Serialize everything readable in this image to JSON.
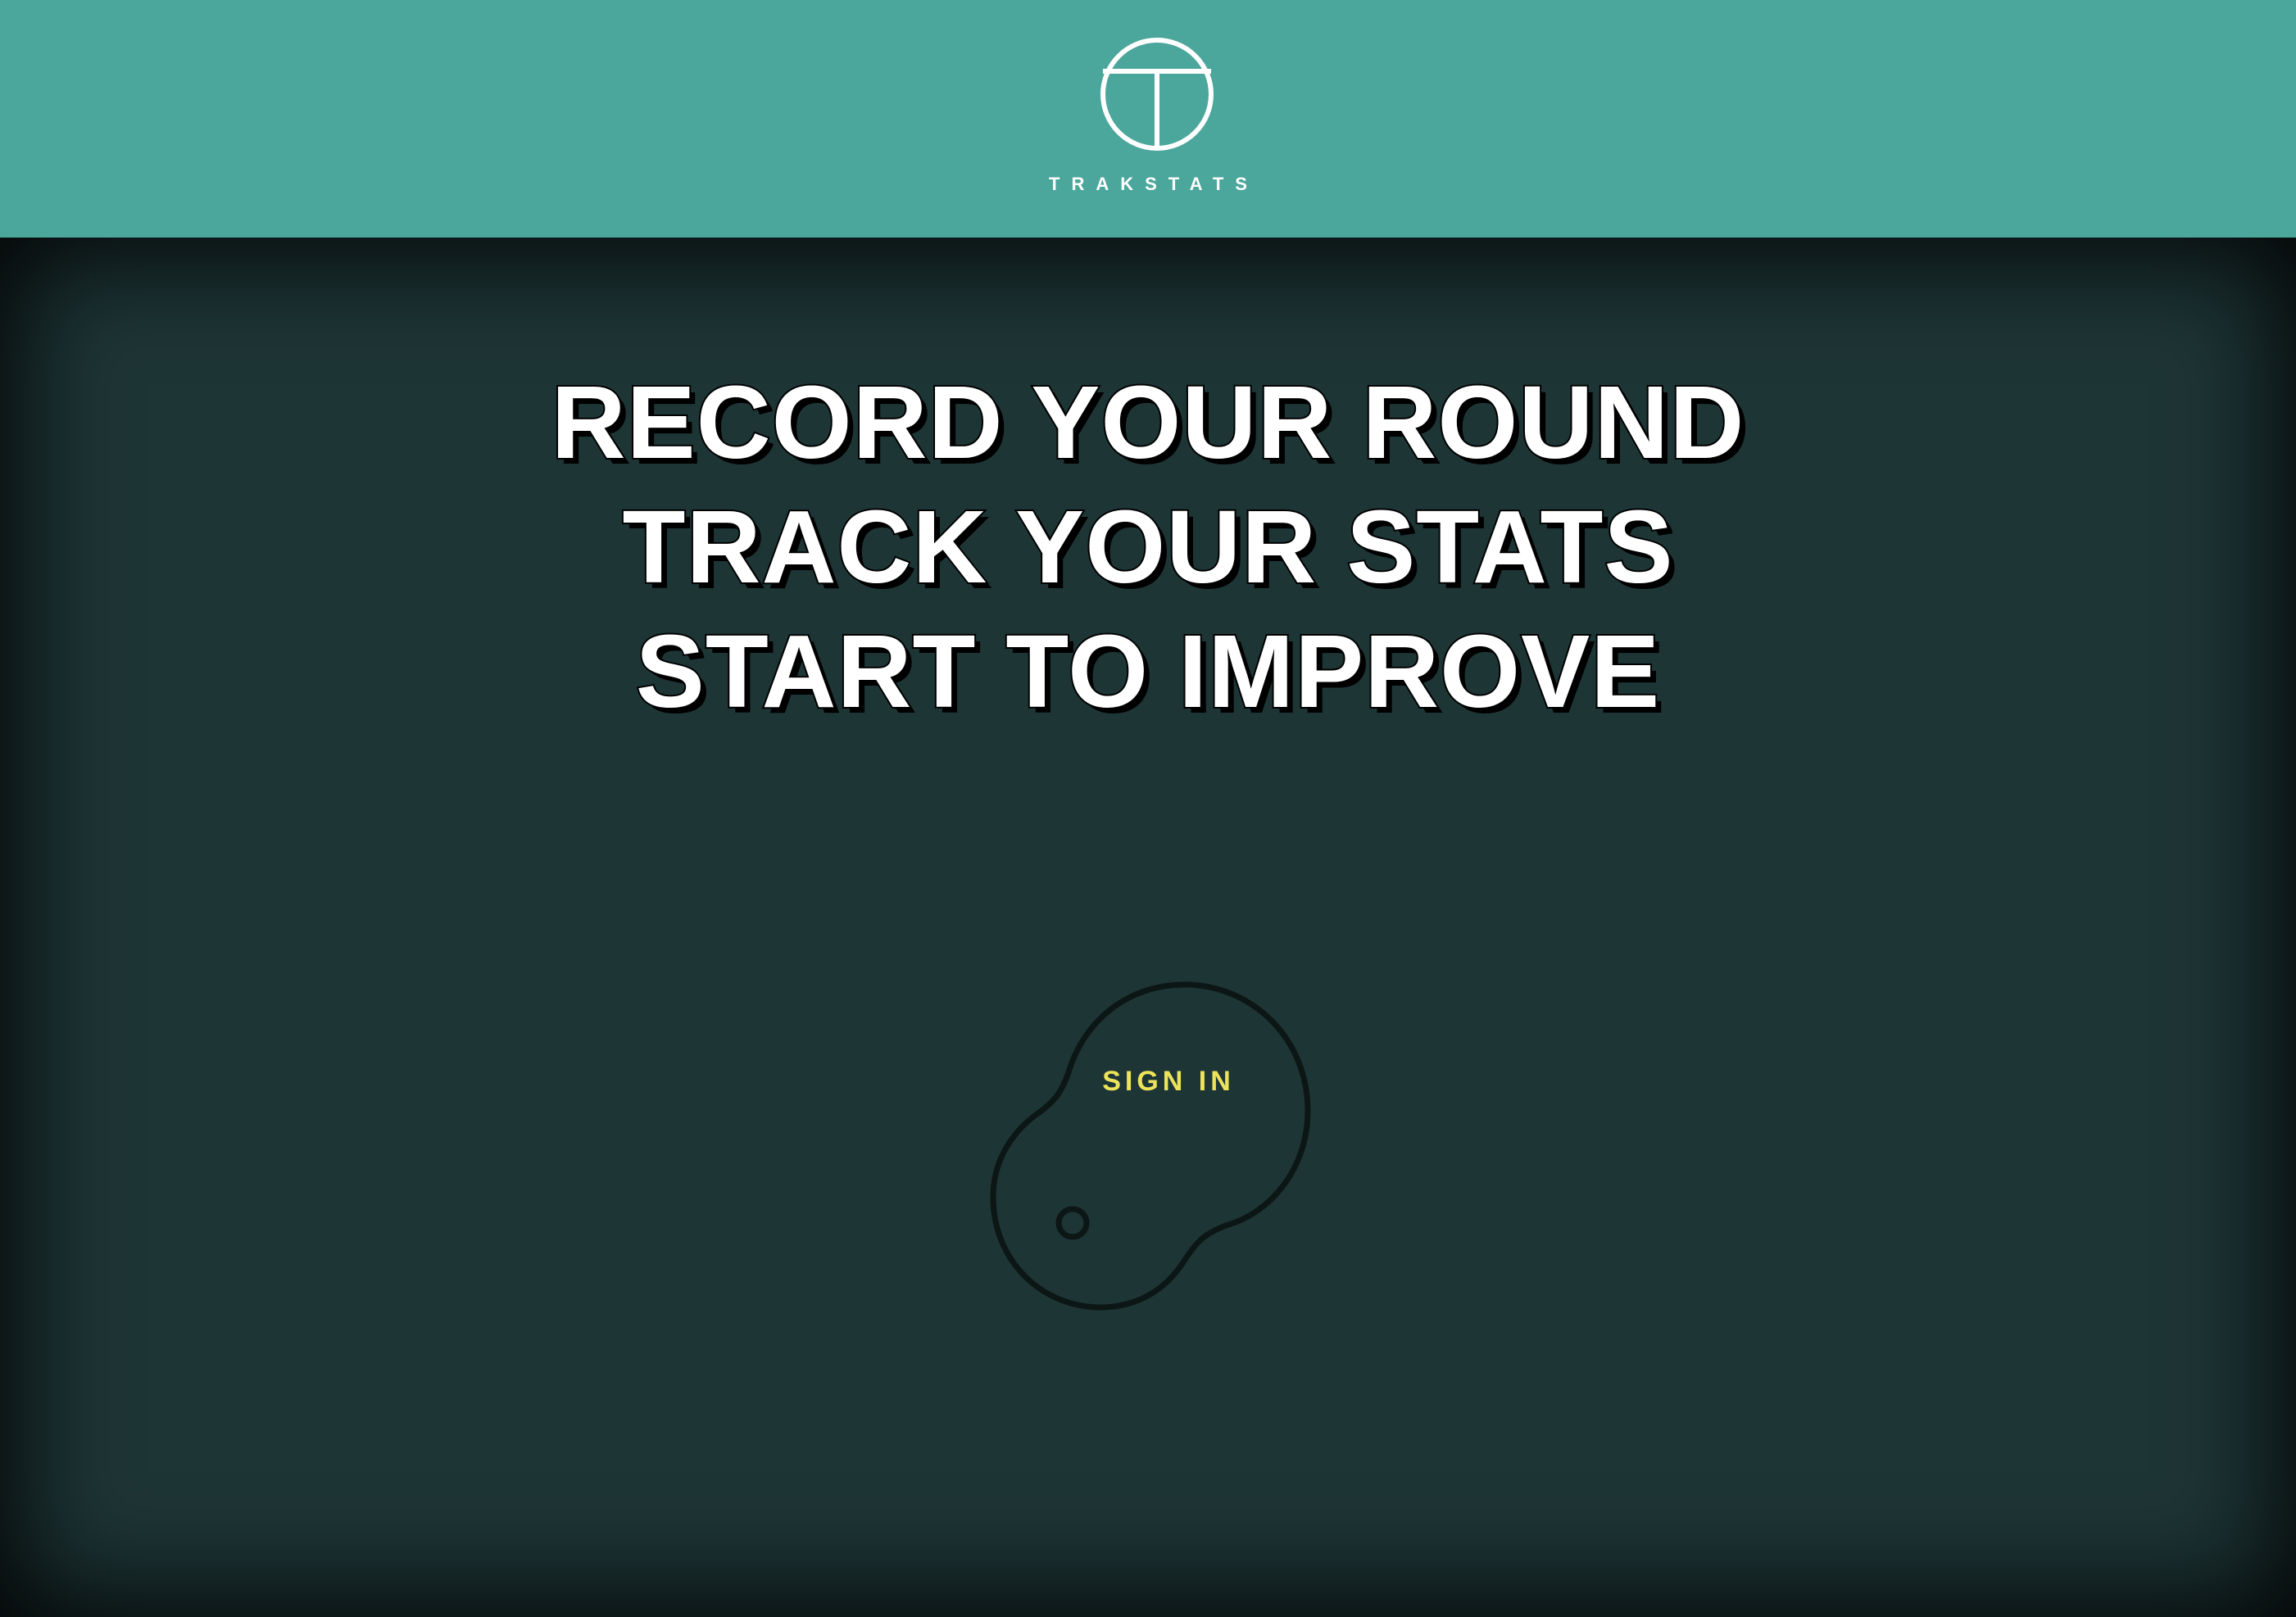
{
  "header": {
    "brand_name": "TRAKSTATS",
    "logo_icon": "trakstats-logo-icon",
    "background_color": "#4ba69c"
  },
  "hero": {
    "headline_lines": [
      "RECORD YOUR ROUND",
      "TRACK YOUR STATS",
      "START TO IMPROVE"
    ],
    "background_color": "#1e3536",
    "text_color": "#ffffff"
  },
  "signin": {
    "label": "SIGN IN",
    "icon": "golf-green-icon",
    "label_color": "#ece35a"
  }
}
